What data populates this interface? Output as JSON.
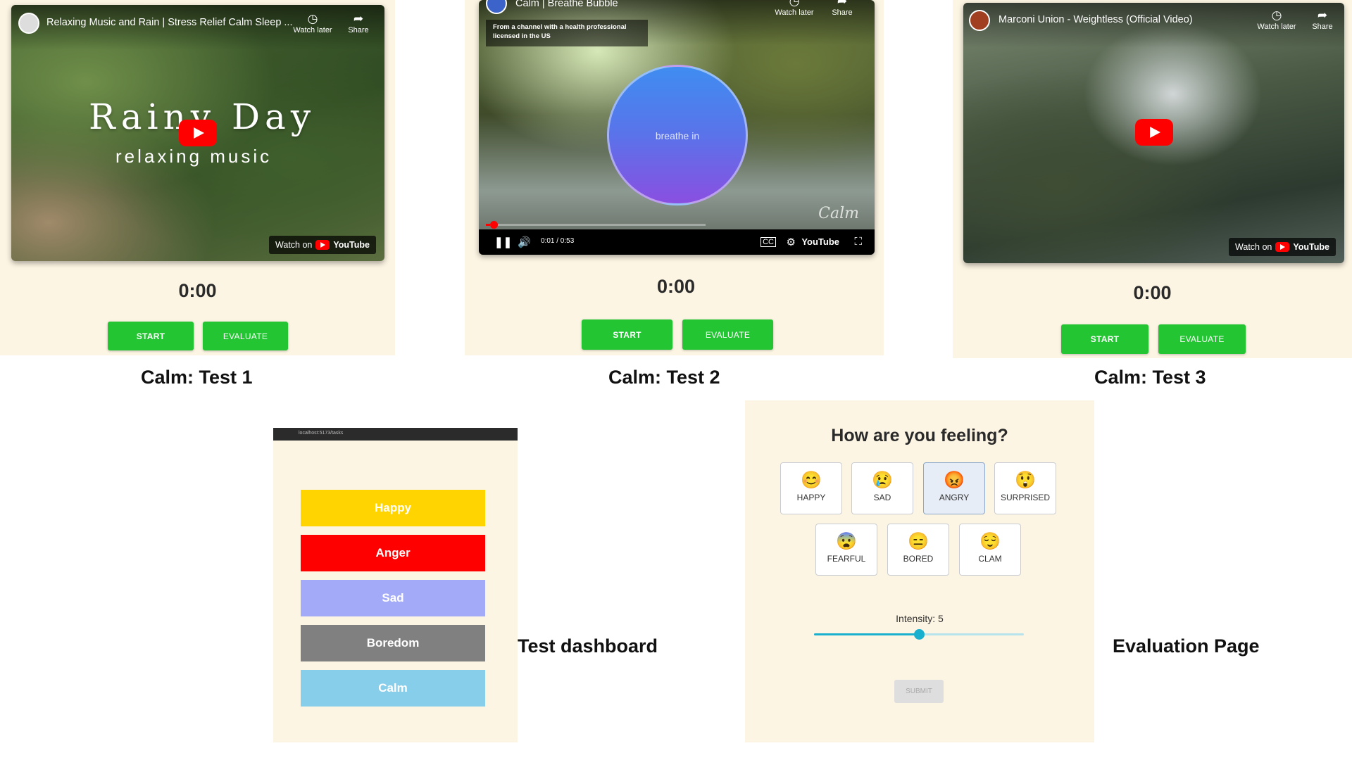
{
  "tests": [
    {
      "video_title": "Relaxing Music and Rain | Stress Relief Calm Sleep ...",
      "overlay_title": "Rainy Day",
      "overlay_subtitle": "relaxing music",
      "watch_later": "Watch later",
      "share": "Share",
      "watch_on": "Watch on",
      "youtube": "YouTube",
      "timer": "0:00",
      "start": "START",
      "evaluate": "EVALUATE",
      "caption": "Calm: Test 1"
    },
    {
      "video_title": "Calm | Breathe Bubble",
      "health_notice": "From a channel with a health professional licensed in the US",
      "breathe": "breathe in",
      "brand_mark": "Calm",
      "watch_later": "Watch later",
      "share": "Share",
      "time": "0:01 / 0:53",
      "progress": 0.02,
      "youtube": "YouTube",
      "timer": "0:00",
      "start": "START",
      "evaluate": "EVALUATE",
      "caption": "Calm: Test 2"
    },
    {
      "video_title": "Marconi Union - Weightless (Official Video)",
      "watch_later": "Watch later",
      "share": "Share",
      "watch_on": "Watch on",
      "youtube": "YouTube",
      "timer": "0:00",
      "start": "START",
      "evaluate": "EVALUATE",
      "caption": "Calm: Test 3"
    }
  ],
  "dashboard": {
    "url": "localhost:5173/tasks",
    "tasks": [
      {
        "label": "Happy",
        "color": "#ffd400"
      },
      {
        "label": "Anger",
        "color": "#ff0000"
      },
      {
        "label": "Sad",
        "color": "#a3aaf7"
      },
      {
        "label": "Boredom",
        "color": "#808080"
      },
      {
        "label": "Calm",
        "color": "#87ceeb"
      }
    ],
    "caption": "Test dashboard"
  },
  "evaluation": {
    "title": "How are you feeling?",
    "emotions": [
      {
        "label": "HAPPY",
        "icon": "smiling-face-icon",
        "glyph": "😊"
      },
      {
        "label": "SAD",
        "icon": "sad-face-icon",
        "glyph": "😢"
      },
      {
        "label": "ANGRY",
        "icon": "angry-face-icon",
        "glyph": "😡",
        "selected": true
      },
      {
        "label": "SURPRISED",
        "icon": "surprised-face-icon",
        "glyph": "😲"
      },
      {
        "label": "FEARFUL",
        "icon": "fearful-face-icon",
        "glyph": "😨"
      },
      {
        "label": "BORED",
        "icon": "bored-face-icon",
        "glyph": "😑"
      },
      {
        "label": "CLAM",
        "icon": "relieved-face-icon",
        "glyph": "😌"
      }
    ],
    "intensity_label": "Intensity: 5",
    "intensity": 5,
    "intensity_max": 10,
    "submit": "SUBMIT",
    "caption": "Evaluation Page"
  },
  "colors": {
    "panel_bg": "#fdf5e3",
    "button_green": "#23c533",
    "slider": "#19b0cf",
    "youtube_red": "#ff0000"
  }
}
